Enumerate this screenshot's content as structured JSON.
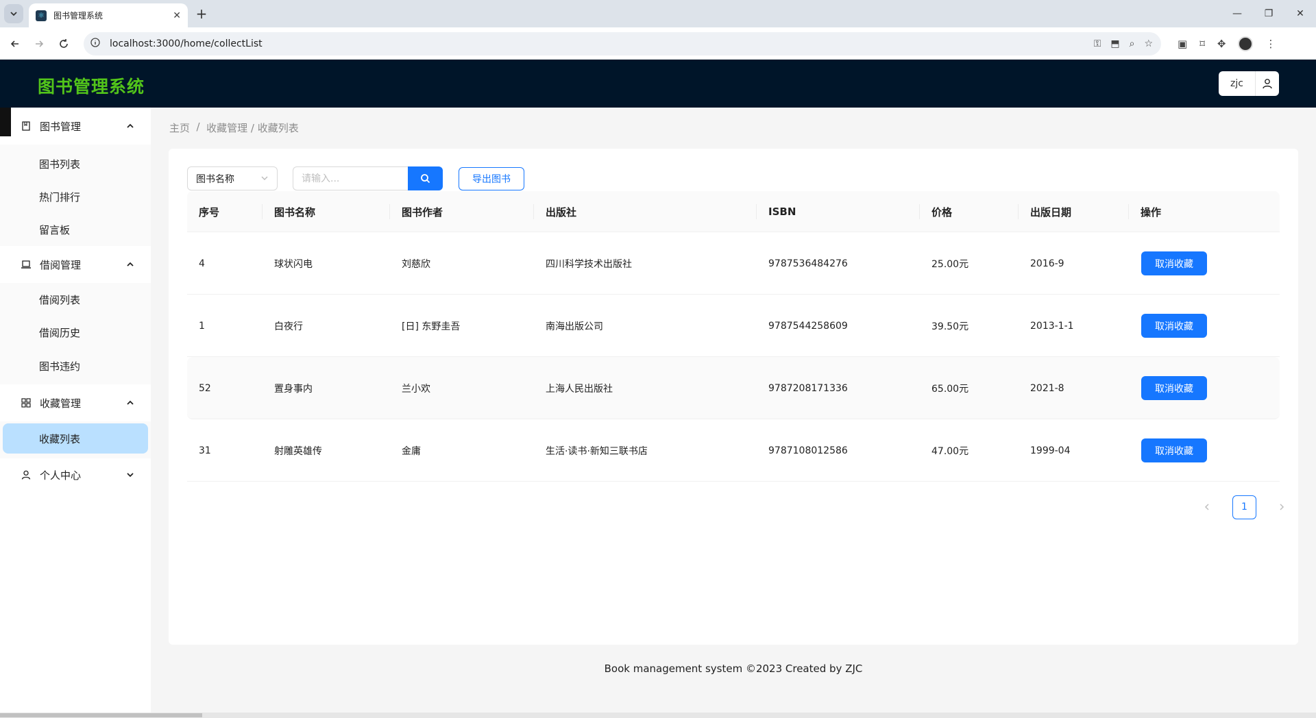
{
  "browser": {
    "tab_title": "图书管理系统",
    "tab_close": "✕",
    "new_tab": "+",
    "url": "localhost:3000/home/collectList",
    "window_controls": {
      "minimize": "—",
      "restore": "❐",
      "close": "✕"
    }
  },
  "header": {
    "logo": "图书管理系统",
    "username": "zjc"
  },
  "sidebar": {
    "groups": [
      {
        "label": "图书管理",
        "icon": "book-icon",
        "expanded": true,
        "items": [
          {
            "label": "图书列表"
          },
          {
            "label": "热门排行"
          },
          {
            "label": "留言板"
          }
        ]
      },
      {
        "label": "借阅管理",
        "icon": "laptop-icon",
        "expanded": true,
        "items": [
          {
            "label": "借阅列表"
          },
          {
            "label": "借阅历史"
          },
          {
            "label": "图书违约"
          }
        ]
      },
      {
        "label": "收藏管理",
        "icon": "grid-icon",
        "expanded": true,
        "items": [
          {
            "label": "收藏列表",
            "active": true
          }
        ]
      },
      {
        "label": "个人中心",
        "icon": "user-icon",
        "expanded": false,
        "items": []
      }
    ]
  },
  "breadcrumb": {
    "home": "主页",
    "sep": "  /  ",
    "current": "收藏管理 / 收藏列表"
  },
  "toolbar": {
    "select_value": "图书名称",
    "search_placeholder": "请输入...",
    "export_label": "导出图书"
  },
  "table": {
    "columns": [
      "序号",
      "图书名称",
      "图书作者",
      "出版社",
      "ISBN",
      "价格",
      "出版日期",
      "操作"
    ],
    "rows": [
      {
        "id": "4",
        "name": "球状闪电",
        "author": "刘慈欣",
        "publisher": "四川科学技术出版社",
        "isbn": "9787536484276",
        "price": "25.00元",
        "date": "2016-9",
        "action": "取消收藏"
      },
      {
        "id": "1",
        "name": "白夜行",
        "author": "[日] 东野圭吾",
        "publisher": "南海出版公司",
        "isbn": "9787544258609",
        "price": "39.50元",
        "date": "2013-1-1",
        "action": "取消收藏"
      },
      {
        "id": "52",
        "name": "置身事内",
        "author": "兰小欢",
        "publisher": "上海人民出版社",
        "isbn": "9787208171336",
        "price": "65.00元",
        "date": "2021-8",
        "action": "取消收藏"
      },
      {
        "id": "31",
        "name": "射雕英雄传",
        "author": "金庸",
        "publisher": "生活·读书·新知三联书店",
        "isbn": "9787108012586",
        "price": "47.00元",
        "date": "1999-04",
        "action": "取消收藏"
      }
    ]
  },
  "pagination": {
    "current_page": "1"
  },
  "footer": {
    "text": "Book management system ©2023 Created by ZJC"
  },
  "colors": {
    "primary": "#1677ff",
    "header_bg": "#001529",
    "logo": "#52c41a",
    "active_item_bg": "#bae0ff"
  }
}
